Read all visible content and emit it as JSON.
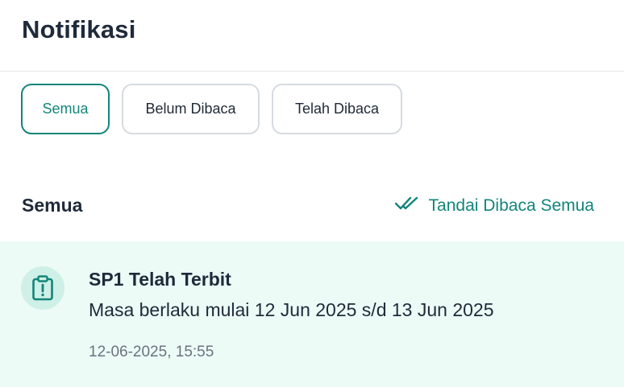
{
  "header": {
    "title": "Notifikasi"
  },
  "filters": [
    {
      "label": "Semua",
      "active": true
    },
    {
      "label": "Belum Dibaca",
      "active": false
    },
    {
      "label": "Telah Dibaca",
      "active": false
    }
  ],
  "section": {
    "title": "Semua",
    "mark_all_label": "Tandai Dibaca Semua",
    "mark_all_icon": "double-check-icon"
  },
  "notifications": [
    {
      "icon": "clipboard-alert-icon",
      "title": "SP1 Telah Terbit",
      "body": "Masa berlaku mulai 12 Jun 2025 s/d 13 Jun 2025",
      "time": "12-06-2025, 15:55"
    }
  ],
  "colors": {
    "accent": "#13857a",
    "unread_bg": "#edfbf7",
    "icon_bg": "#cff0e6"
  }
}
